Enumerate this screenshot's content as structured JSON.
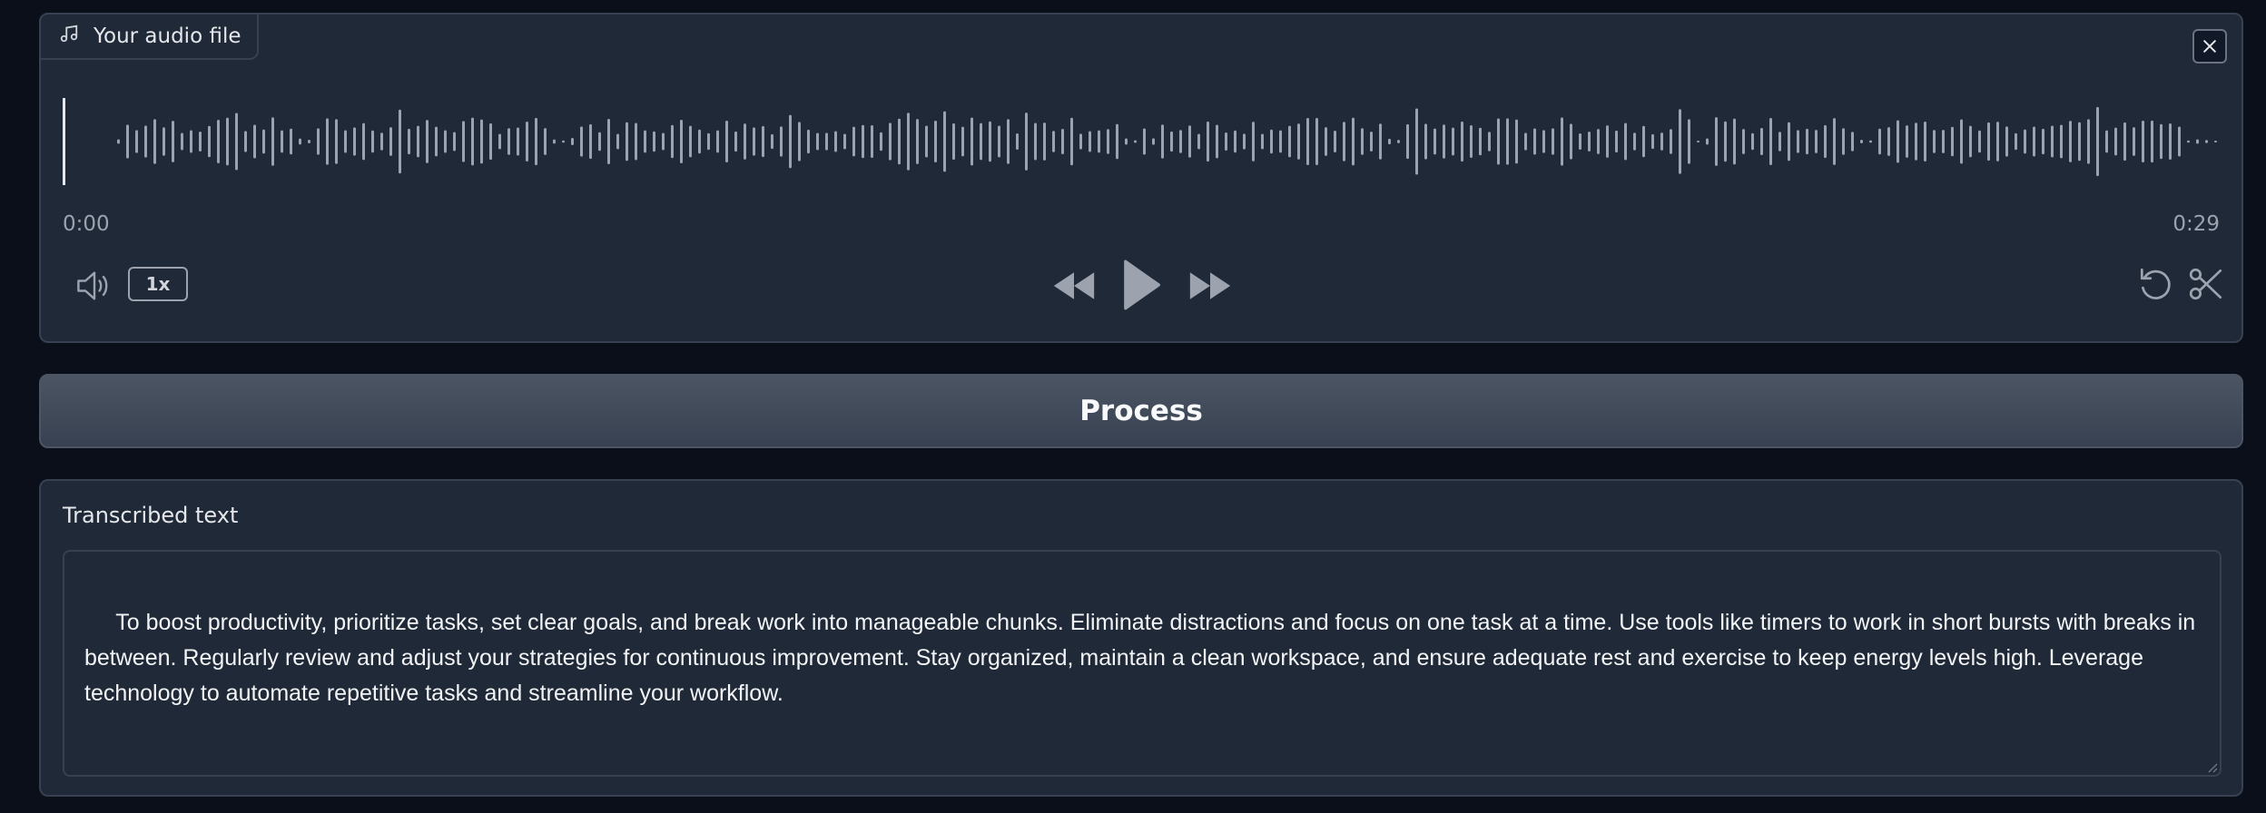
{
  "audio": {
    "label": "Your audio file",
    "label_icon": "music-note-icon",
    "time_start": "0:00",
    "time_end": "0:29",
    "speed": "1x",
    "controls": [
      "volume-icon",
      "rewind-icon",
      "play-icon",
      "fast-forward-icon",
      "reset-icon",
      "scissors-icon"
    ],
    "close_icon": "close-icon"
  },
  "process": {
    "label": "Process"
  },
  "transcription": {
    "label": "Transcribed text",
    "value": " To boost productivity, prioritize tasks, set clear goals, and break work into manageable chunks. Eliminate distractions and focus on one task at a time. Use tools like timers to work in short bursts with breaks in between. Regularly review and adjust your strategies for continuous improvement. Stay organized, maintain a clean workspace, and ensure adequate rest and exercise to keep energy levels high. Leverage technology to automate repetitive tasks and streamline your workflow."
  },
  "colors": {
    "background": "#0b0f19",
    "panel": "#1f2937",
    "border": "#374151",
    "waveform": "#9ca3af",
    "playhead": "#e5e7eb"
  }
}
